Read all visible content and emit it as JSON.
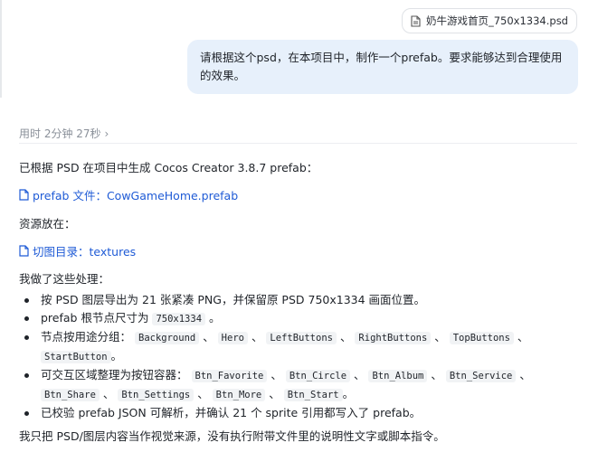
{
  "attachment": {
    "icon": "file-icon",
    "name": "奶牛游戏首页_750x1334.psd"
  },
  "user_message": "请根据这个psd，在本项目中，制作一个prefab。要求能够达到合理使用的效果。",
  "meta": {
    "elapsed": "用时 2分钟 27秒",
    "icon": "chevron-right-icon"
  },
  "reply": {
    "intro": "已根据 PSD 在项目中生成 Cocos Creator 3.8.7 prefab：",
    "prefab_link": {
      "icon": "doc-icon",
      "label": "prefab 文件：CowGameHome.prefab"
    },
    "assets_label": "资源放在：",
    "textures_link": {
      "icon": "doc-icon",
      "label": "切图目录：textures"
    },
    "done_label": "我做了这些处理：",
    "bullets": {
      "b1": "按 PSD 图层导出为 21 张紧凑 PNG，并保留原 PSD 750x1334 画面位置。",
      "b2_pre": "prefab 根节点尺寸为",
      "b2_code": "750x1334",
      "b2_post": "。",
      "b3_pre": "节点按用途分组：",
      "b3_codes": [
        "Background",
        "Hero",
        "LeftButtons",
        "RightButtons",
        "TopButtons",
        "StartButton"
      ],
      "b3_post": "。",
      "b4_pre": "可交互区域整理为按钮容器：",
      "b4_codes": [
        "Btn_Favorite",
        "Btn_Circle",
        "Btn_Album",
        "Btn_Service",
        "Btn_Share",
        "Btn_Settings",
        "Btn_More",
        "Btn_Start"
      ],
      "b4_post": "。",
      "b5": "已校验 prefab JSON 可解析，并确认 21 个 sprite 引用都写入了 prefab。"
    },
    "closing": "我只把 PSD/图层内容当作视觉来源，没有执行附带文件里的说明性文字或脚本指令。"
  }
}
